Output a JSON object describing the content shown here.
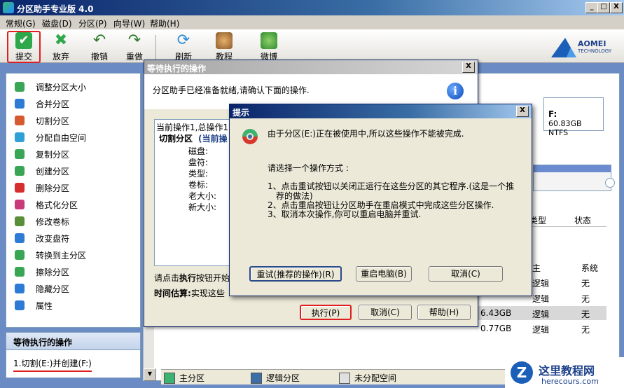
{
  "window": {
    "title": "分区助手专业版 4.0",
    "min": "_",
    "max": "□",
    "close": "X"
  },
  "menu": [
    "常规(G)",
    "磁盘(D)",
    "分区(P)",
    "向导(W)",
    "帮助(H)"
  ],
  "toolbar": {
    "submit": "提交",
    "discard": "放弃",
    "undo": "撤销",
    "redo": "重做",
    "refresh": "刷新",
    "tutorial": "教程",
    "weibo": "微博"
  },
  "logo": {
    "brand": "AOMEI",
    "sub": "TECHNOLOGY"
  },
  "sidebar": {
    "items": [
      {
        "label": "调整分区大小",
        "color": "#3aa655"
      },
      {
        "label": "合并分区",
        "color": "#2e7bd6"
      },
      {
        "label": "切割分区",
        "color": "#d65a2e"
      },
      {
        "label": "分配自由空间",
        "color": "#2ea0d6"
      },
      {
        "label": "复制分区",
        "color": "#3aa655"
      },
      {
        "label": "创建分区",
        "color": "#3aa655"
      },
      {
        "label": "删除分区",
        "color": "#d62e2e"
      },
      {
        "label": "格式化分区",
        "color": "#c93a7b"
      },
      {
        "label": "修改卷标",
        "color": "#5a8f3a"
      },
      {
        "label": "改变盘符",
        "color": "#2e7bd6"
      },
      {
        "label": "转换到主分区",
        "color": "#3aa655"
      },
      {
        "label": "擦除分区",
        "color": "#3aa655"
      },
      {
        "label": "隐藏分区",
        "color": "#2e7bd6"
      },
      {
        "label": "属性",
        "color": "#2e7bd6"
      }
    ]
  },
  "pending": {
    "header": "等待执行的操作",
    "item": "1.切割(E:)并创建(F:)"
  },
  "disk": {
    "f_label": "F:",
    "f_size": "60.83GB NTFS"
  },
  "grid": {
    "headers": {
      "type": "类型",
      "status": "状态"
    },
    "rows": [
      {
        "size": "",
        "type": "主",
        "status": "系统"
      },
      {
        "size": "",
        "type": "逻辑",
        "status": "无"
      },
      {
        "size": "",
        "type": "逻辑",
        "status": "无"
      },
      {
        "size": "6.43GB",
        "type": "逻辑",
        "status": "无"
      },
      {
        "size": "0.77GB",
        "type": "逻辑",
        "status": "无"
      }
    ]
  },
  "legend": {
    "primary": "主分区",
    "logical": "逻辑分区",
    "unalloc": "未分配空间"
  },
  "dialog1": {
    "title": "等待执行的操作",
    "message": "分区助手已经准备就绪,请确认下面的操作.",
    "ops": {
      "line0": "当前操作1,总操作1",
      "line1": "切割分区",
      "line1b": "(当前操",
      "fields": [
        "磁盘:",
        "盘符:",
        "类型:",
        "卷标:",
        "老大小:",
        "新大小:"
      ]
    },
    "footer1_pre": "请点击",
    "footer1_bold": "执行",
    "footer1_post": "按钮开始",
    "footer2_bold": "时间估算:",
    "footer2_post": "实现这些",
    "buttons": {
      "execute": "执行(P)",
      "cancel": "取消(C)",
      "help": "帮助(H)"
    }
  },
  "dialog2": {
    "title": "提示",
    "message": "由于分区(E:)正在被使用中,所以这些操作不能被完成.",
    "prompt": "请选择一个操作方式 :",
    "options": [
      "1、点击重试按钮以关闭正运行在这些分区的其它程序.(这是一个推",
      "荐的做法)",
      "2、点击重启按钮让分区助手在重启模式中完成这些分区操作.",
      "3、取消本次操作,你可以重启电脑并重试."
    ],
    "buttons": {
      "retry": "重试(推荐的操作)(R)",
      "reboot": "重启电脑(B)",
      "cancel": "取消(C)"
    }
  },
  "watermark": {
    "name": "这里教程网",
    "url": "herecours.com"
  }
}
